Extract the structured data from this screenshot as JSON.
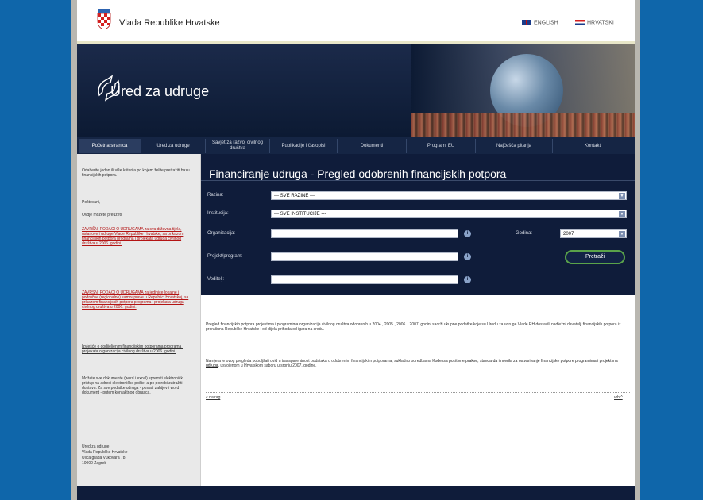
{
  "header": {
    "gov_name": "Vlada Republike Hrvatske",
    "lang_en": "ENGLISH",
    "lang_hr": "HRVATSKI"
  },
  "banner": {
    "title": "Ured za udruge"
  },
  "nav": {
    "items": [
      "Početna stranica",
      "Ured za udruge",
      "Savjet za razvoj civilnog društva",
      "Publikacije i časopisi",
      "Dokumenti",
      "Programi EU",
      "Najčešća pitanja",
      "Kontakt"
    ],
    "active_index": 0
  },
  "sidebar": {
    "intro": "Odaberite jedan ili više kriterija po kojem želite pretražiti bazu financijskih potpora.",
    "p1": "Poštovani,",
    "p2": "Ovdje možete preuzeti",
    "link_red_1": "ZAVRŠNI PODACI O UDRUGAMA za sva državna tijela, ustanove i udruge Vlade Republike Hrvatske, sa prikazom financijskih potpora programa i projekata udruga civilnog društva u 2006. godini.",
    "link_red_2": "ZAVRŠNI PODACI O UDRUGAMA za jedinice lokalne i područne (regionalne) samouprave u Republici Hrvatskoj, sa prikazom financijskih potpora programa i projekata udruga civilnog društva u 2006. godini.",
    "link_3": "Izvješće o dodijeljenim financijskim potporama programa i projekata organizacija civilnog društva u 2006. godini.",
    "note": "Možete sve dokumente (word i excel) spremiti elektronički pristup na adresi elektroničke pošte, a po potrebi zatražiti dostavu. Za sve podatke udruga - poslati zahtjev i word dokument - putem kontaktnog obrasca.",
    "address_1": "Ured za udruge",
    "address_2": "Vlada Republike Hrvatske",
    "address_3": "Ulica grada Vukovara 78",
    "address_4": "10000 Zagreb"
  },
  "main": {
    "title": "Financiranje udruga - Pregled odobrenih financijskih potpora",
    "form": {
      "razina_label": "Razina:",
      "razina_value": "--- SVE RAZINE ---",
      "institucija_label": "Institucija:",
      "institucija_value": "--- SVE INSTITUCIJE ---",
      "organizacija_label": "Organizacija:",
      "organizacija_value": "",
      "godina_label": "Godina:",
      "godina_value": "2007",
      "projekt_label": "Projekt/program:",
      "projekt_value": "",
      "voditelj_label": "Voditelj:",
      "voditelj_value": "",
      "search_label": "Pretraži",
      "info_icon": "info-icon"
    },
    "paragraph_1": "Pregled financijskih potpora projektima i programima organizacija civilnog društva odobrenih u 2004., 2005., 2006. i 2007. godini sadrži ukupne podatke koje su Uredu za udruge Vlade RH dostavili nadležni davatelji financijskih potpora iz proračuna Republike Hrvatske i od dijela prihoda od igara na sreću.",
    "paragraph_2_a": "Namjera je ovog pregleda poboljšati uvid u transparentnost podataka o odobrenim financijskim potporama, sukladno odredbama",
    "paragraph_2_link": "Kodeksa pozitivne prakse, standarda i mjerila za ostvarivanje financijske potpore programima i projektima udruga",
    "paragraph_2_b": ", usvojenom u Hrvatskom saboru u srpnju 2007. godine.",
    "back_link": "« natrag",
    "top_link": "vrh ^"
  },
  "colors": {
    "background": "#0f66aa",
    "dark_navy": "#0f1c3a",
    "accent_green": "#5aa34a",
    "link_red": "#b31313"
  }
}
